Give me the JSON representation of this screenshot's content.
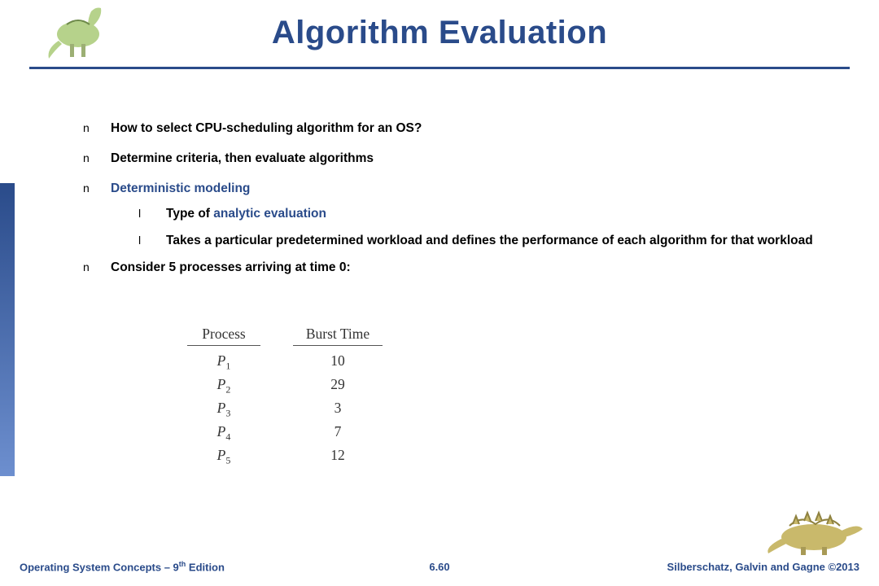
{
  "title": "Algorithm Evaluation",
  "bullets": {
    "b1": "How to select CPU-scheduling algorithm for an OS?",
    "b2": "Determine criteria, then evaluate algorithms",
    "b3_term": "Deterministic modeling",
    "b3_sub1_prefix": "Type of ",
    "b3_sub1_term": "analytic evaluation",
    "b3_sub2": "Takes a particular predetermined workload and defines the performance of each algorithm  for that workload",
    "b4": "Consider 5 processes arriving at time 0:"
  },
  "bullet_glyph_n": "n",
  "bullet_glyph_l": "l",
  "table": {
    "header_process": "Process",
    "header_burst": "Burst Time",
    "rows": [
      {
        "p": "P",
        "sub": "1",
        "burst": "10"
      },
      {
        "p": "P",
        "sub": "2",
        "burst": "29"
      },
      {
        "p": "P",
        "sub": "3",
        "burst": "3"
      },
      {
        "p": "P",
        "sub": "4",
        "burst": "7"
      },
      {
        "p": "P",
        "sub": "5",
        "burst": "12"
      }
    ]
  },
  "footer": {
    "left_prefix": "Operating System Concepts – 9",
    "left_th": "th",
    "left_suffix": " Edition",
    "center": "6.60",
    "right": "Silberschatz, Galvin and Gagne ©2013"
  },
  "logo": {
    "top_alt": "dinosaur-logo",
    "bottom_alt": "dinosaur-logo"
  }
}
